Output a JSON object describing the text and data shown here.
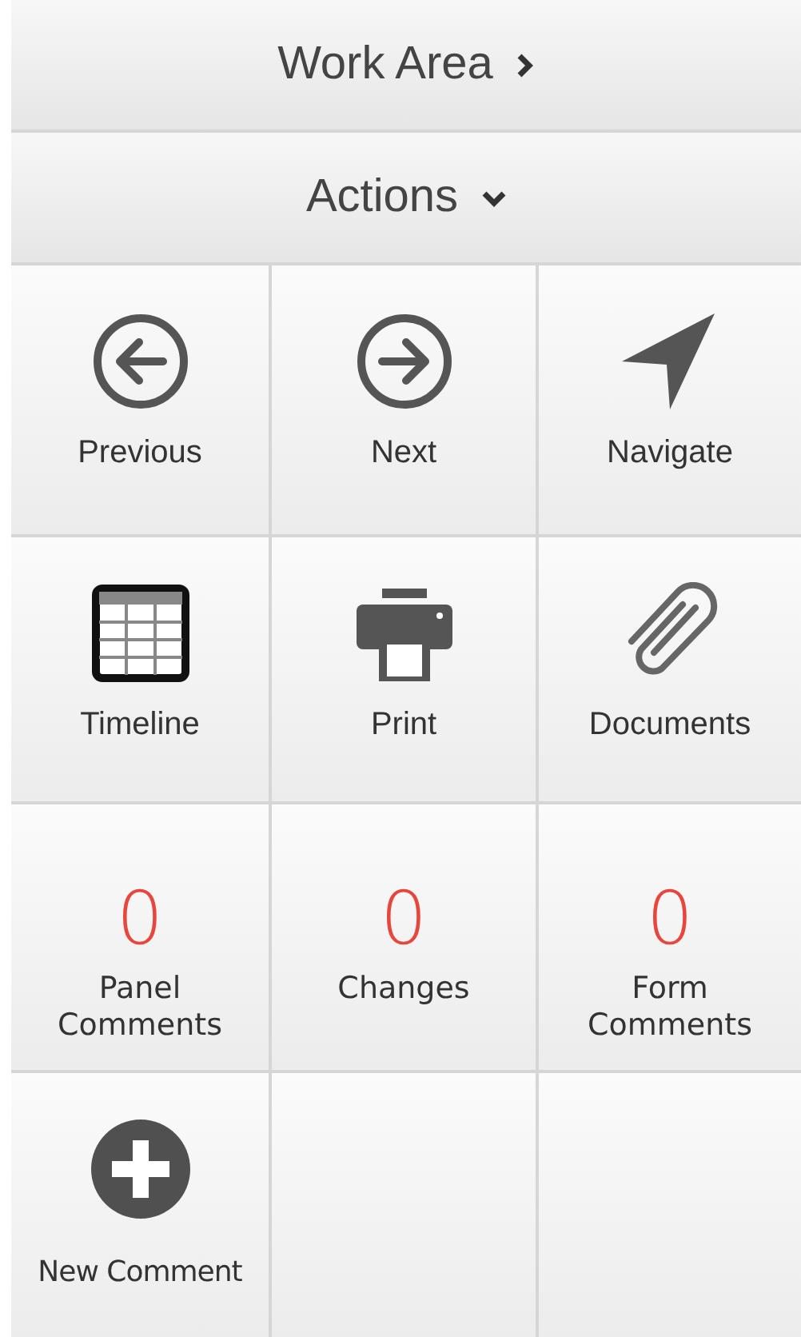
{
  "sections": [
    {
      "label": "Work Area",
      "expanded": false
    },
    {
      "label": "Actions",
      "expanded": true
    }
  ],
  "tiles": [
    {
      "kind": "previous",
      "label": "Previous"
    },
    {
      "kind": "next",
      "label": "Next"
    },
    {
      "kind": "navigate",
      "label": "Navigate"
    },
    {
      "kind": "timeline",
      "label": "Timeline"
    },
    {
      "kind": "print",
      "label": "Print"
    },
    {
      "kind": "documents",
      "label": "Documents"
    },
    {
      "kind": "count",
      "count": "0",
      "label": "Panel Comments"
    },
    {
      "kind": "count",
      "count": "0",
      "label": "Changes"
    },
    {
      "kind": "count",
      "count": "0",
      "label": "Form Comments"
    },
    {
      "kind": "add",
      "label": "New Comment"
    }
  ]
}
